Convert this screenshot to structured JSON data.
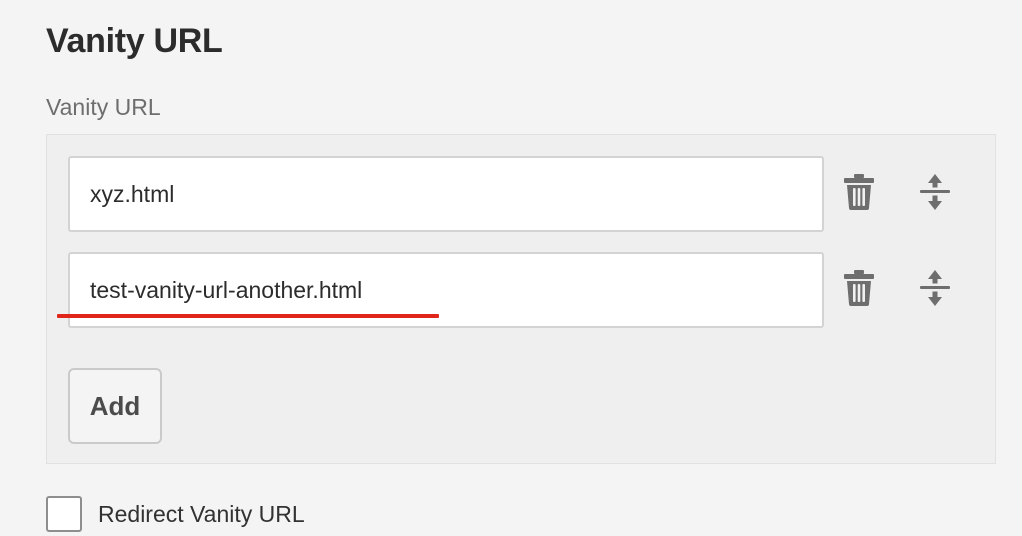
{
  "section": {
    "title": "Vanity URL"
  },
  "field": {
    "label": "Vanity URL",
    "items": [
      {
        "value": "xyz.html"
      },
      {
        "value": "test-vanity-url-another.html"
      }
    ],
    "add_label": "Add"
  },
  "redirect": {
    "label": "Redirect Vanity URL",
    "checked": false
  },
  "icons": {
    "delete": "trash-icon",
    "reorder": "move-vertical-icon"
  },
  "colors": {
    "annotation": "#e1251b",
    "icon": "#6e6e6e",
    "panel": "#efefef"
  }
}
